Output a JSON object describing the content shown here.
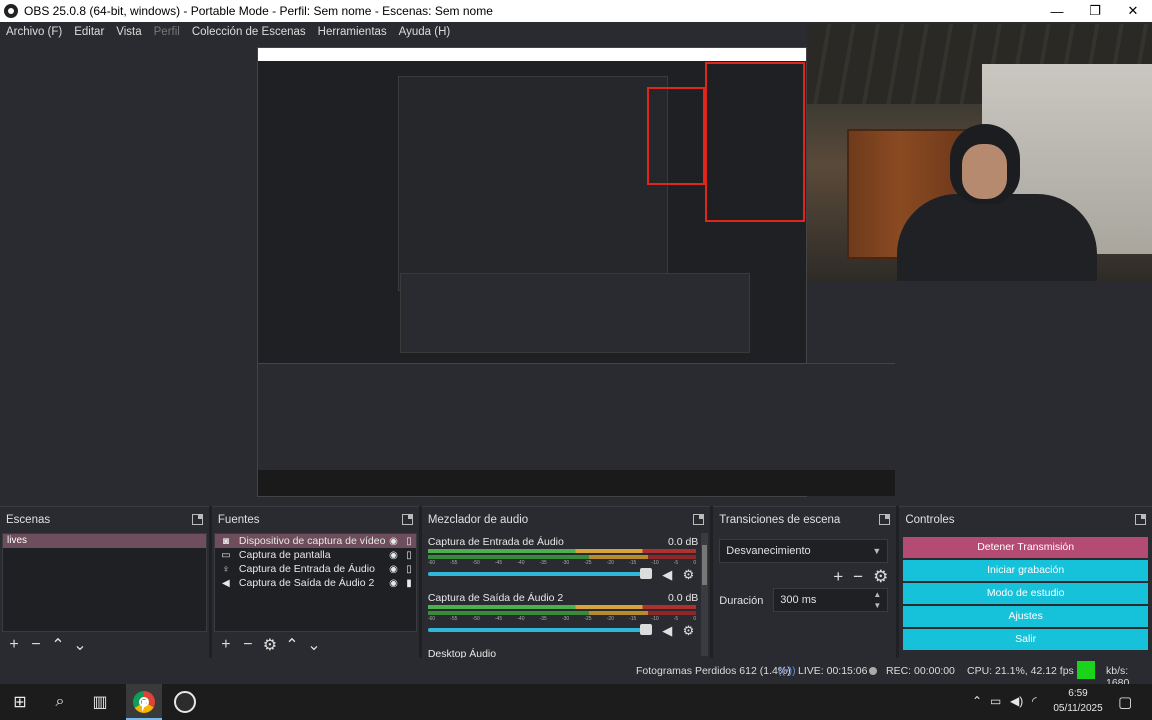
{
  "window": {
    "title": "OBS 25.0.8 (64-bit, windows) - Portable Mode - Perfil: Sem nome - Escenas: Sem nome",
    "minimize": "—",
    "maximize": "❐",
    "close": "✕"
  },
  "menu": [
    "Archivo (F)",
    "Editar",
    "Vista",
    "Perfil",
    "Colección de Escenas",
    "Herramientas",
    "Ayuda (H)"
  ],
  "docks": {
    "scenes": {
      "title": "Escenas",
      "items": [
        "lives"
      ]
    },
    "sources": {
      "title": "Fuentes",
      "items": [
        {
          "label": "Dispositivo de captura de vídeo",
          "icon": "camera-icon"
        },
        {
          "label": "Captura de pantalla",
          "icon": "monitor-icon"
        },
        {
          "label": "Captura de Entrada de Áudio",
          "icon": "microphone-icon"
        },
        {
          "label": "Captura de Saída de Áudio 2",
          "icon": "speaker-icon"
        }
      ]
    },
    "mixer": {
      "title": "Mezclador de audio",
      "channels": [
        {
          "name": "Captura de Entrada de Áudio",
          "db": "0.0 dB"
        },
        {
          "name": "Captura de Saída de Áudio 2",
          "db": "0.0 dB"
        },
        {
          "name": "Desktop Áudio",
          "db": ""
        }
      ],
      "ticks": [
        "-60",
        "-55",
        "-50",
        "-45",
        "-40",
        "-35",
        "-30",
        "-25",
        "-20",
        "-15",
        "-10",
        "-5",
        "0"
      ]
    },
    "transitions": {
      "title": "Transiciones de escena",
      "selected": "Desvanecimiento",
      "duration_label": "Duración",
      "duration_value": "300 ms"
    },
    "controls": {
      "title": "Controles",
      "buttons": [
        "Detener Transmisión",
        "Iniciar grabación",
        "Modo de estudio",
        "Ajustes",
        "Salir"
      ]
    }
  },
  "status": {
    "dropped": "Fotogramas Perdidos 612 (1.4%)",
    "live": "LIVE: 00:15:06",
    "rec": "REC: 00:00:00",
    "cpu": "CPU: 21.1%, 42.12 fps",
    "bitrate": "kb/s: 1680"
  },
  "taskbar": {
    "time": "6:59",
    "date": "05/11/2025"
  },
  "colors": {
    "accent_cyan": "#16c2da",
    "stop_button": "#b34b73",
    "status_green": "#1bd31b",
    "selection_red_frame": "#e0261c"
  }
}
